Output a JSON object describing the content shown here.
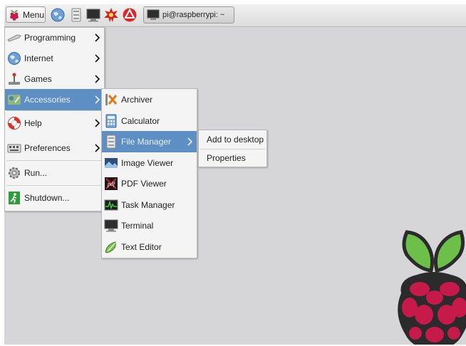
{
  "taskbar": {
    "menu_label": "Menu",
    "launchers": [
      "web-browser-icon",
      "file-manager-icon",
      "terminal-icon",
      "mathematica-icon",
      "wolfram-icon"
    ],
    "task_label": "pi@raspberrypi: ~"
  },
  "main_menu": {
    "items": [
      {
        "label": "Programming",
        "icon": "programming-icon",
        "submenu": true
      },
      {
        "label": "Internet",
        "icon": "globe-icon",
        "submenu": true
      },
      {
        "label": "Games",
        "icon": "games-icon",
        "submenu": true
      },
      {
        "label": "Accessories",
        "icon": "accessories-icon",
        "submenu": true,
        "active": true
      },
      {
        "label": "Help",
        "icon": "lifebuoy-icon",
        "submenu": true
      },
      {
        "label": "Preferences",
        "icon": "preferences-icon",
        "submenu": true
      },
      {
        "label": "Run...",
        "icon": "run-icon"
      },
      {
        "label": "Shutdown...",
        "icon": "shutdown-icon"
      }
    ]
  },
  "accessories_menu": {
    "items": [
      {
        "label": "Archiver",
        "icon": "archiver-icon"
      },
      {
        "label": "Calculator",
        "icon": "calculator-icon"
      },
      {
        "label": "File Manager",
        "icon": "file-manager-icon",
        "submenu": true,
        "active": true
      },
      {
        "label": "Image Viewer",
        "icon": "image-viewer-icon"
      },
      {
        "label": "PDF Viewer",
        "icon": "pdf-icon"
      },
      {
        "label": "Task Manager",
        "icon": "task-manager-icon"
      },
      {
        "label": "Terminal",
        "icon": "terminal-icon"
      },
      {
        "label": "Text Editor",
        "icon": "text-editor-icon"
      }
    ]
  },
  "context_menu": {
    "items": [
      {
        "label": "Add to desktop"
      },
      {
        "label": "Properties"
      }
    ]
  },
  "colors": {
    "desktop": "#d6d6d9",
    "highlight": "#5e8fc4",
    "raspberry_red": "#c51a4a",
    "leaf_green": "#6cc04a"
  }
}
